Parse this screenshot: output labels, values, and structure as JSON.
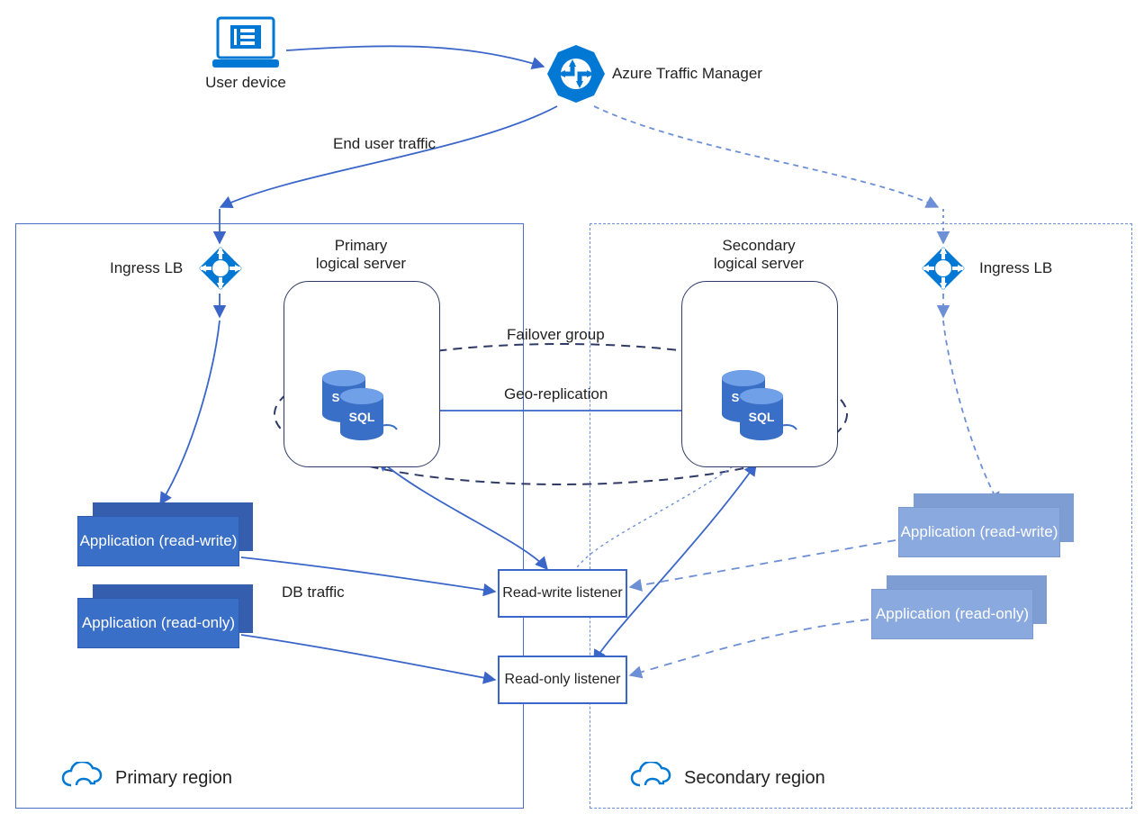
{
  "top": {
    "user_device": "User device",
    "traffic_manager": "Azure Traffic Manager",
    "end_user_traffic": "End user traffic"
  },
  "ingress_lb": {
    "primary": "Ingress LB",
    "secondary": "Ingress LB"
  },
  "servers": {
    "primary": "Primary\nlogical server",
    "secondary": "Secondary\nlogical server",
    "failover_group": "Failover group",
    "geo_replication": "Geo-replication"
  },
  "apps": {
    "primary_rw": "Application\n(read-write)",
    "primary_ro": "Application\n(read-only)",
    "secondary_rw": "Application\n(read-write)",
    "secondary_ro": "Application\n(read-only)"
  },
  "listeners": {
    "rw": "Read-write\nlistener",
    "ro": "Read-only\nlistener"
  },
  "db_traffic": "DB traffic",
  "regions": {
    "primary": "Primary region",
    "secondary": "Secondary region"
  },
  "colors": {
    "azure_blue": "#0078d4",
    "line_blue": "#3a66c9",
    "line_navy": "#2f3b66",
    "faded_blue": "#8aa9de"
  }
}
